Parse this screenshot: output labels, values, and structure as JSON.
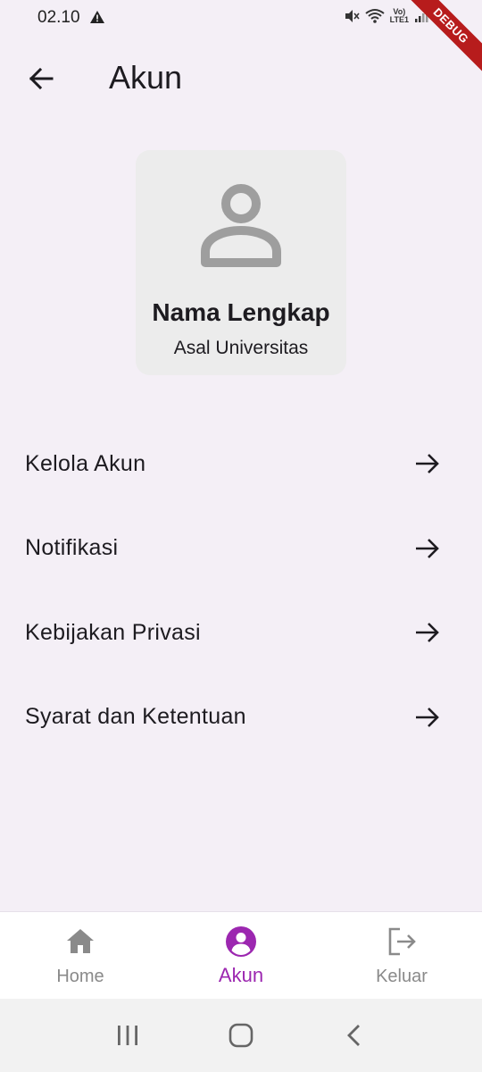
{
  "status_bar": {
    "time": "02.10",
    "volte_top": "Vo)",
    "volte_bottom": "LTE1"
  },
  "debug_banner": "DEBUG",
  "appbar": {
    "title": "Akun",
    "back_icon": "arrow-left-icon"
  },
  "profile": {
    "name": "Nama Lengkap",
    "university": "Asal Universitas",
    "avatar_icon": "person-outline-icon"
  },
  "menu": {
    "items": [
      {
        "label": "Kelola Akun",
        "icon": "arrow-right-icon"
      },
      {
        "label": "Notifikasi",
        "icon": "arrow-right-icon"
      },
      {
        "label": "Kebijakan Privasi",
        "icon": "arrow-right-icon"
      },
      {
        "label": "Syarat dan Ketentuan",
        "icon": "arrow-right-icon"
      }
    ]
  },
  "bottom_nav": {
    "items": [
      {
        "label": "Home",
        "icon": "home-icon",
        "active": false
      },
      {
        "label": "Akun",
        "icon": "account-circle-icon",
        "active": true
      },
      {
        "label": "Keluar",
        "icon": "logout-icon",
        "active": false
      }
    ]
  },
  "colors": {
    "background": "#f4eff6",
    "card": "#ececec",
    "accent": "#9c27b0",
    "inactive": "#8a8a8a",
    "debug_banner": "#b71c1c"
  }
}
